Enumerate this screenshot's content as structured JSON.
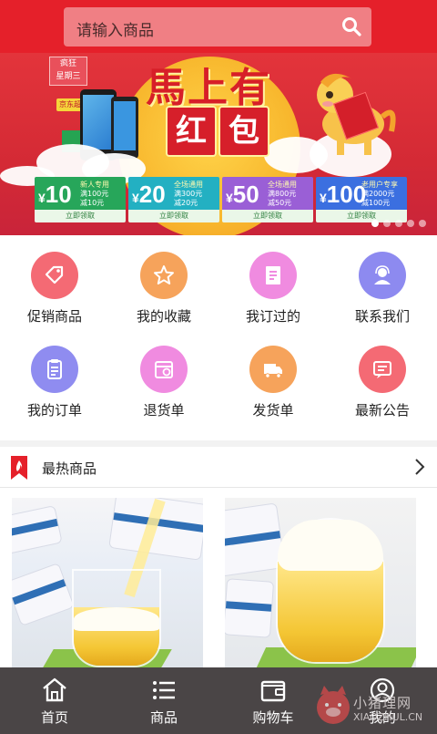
{
  "header": {
    "search_placeholder": "请输入商品",
    "search_icon": "search-icon"
  },
  "banner": {
    "ribbon_lines": [
      "疯狂",
      "星期三"
    ],
    "gift_tag": "京东超",
    "headline_top": "馬上有",
    "headline_bottom": [
      "红",
      "包"
    ],
    "coupons": [
      {
        "amount": "10",
        "tag": "新人专用",
        "line1": "满100元",
        "line2": "减10元",
        "button": "立即领取",
        "color": "#27a65a"
      },
      {
        "amount": "20",
        "tag": "全场通用",
        "line1": "满300元",
        "line2": "减20元",
        "button": "立即领取",
        "color": "#23b0c2"
      },
      {
        "amount": "50",
        "tag": "全场通用",
        "line1": "满800元",
        "line2": "减50元",
        "button": "立即领取",
        "color": "#9a5fd6"
      },
      {
        "amount": "100",
        "tag": "老用户专享",
        "line1": "满2000元",
        "line2": "减100元",
        "button": "立即领取",
        "color": "#3b6fe0"
      }
    ],
    "active_slide": 0,
    "slide_count": 5
  },
  "menu": {
    "items": [
      {
        "label": "促销商品",
        "icon": "price-tag-icon",
        "color": "#f46a74"
      },
      {
        "label": "我的收藏",
        "icon": "star-icon",
        "color": "#f6a35b"
      },
      {
        "label": "我订过的",
        "icon": "document-icon",
        "color": "#f08be0"
      },
      {
        "label": "联系我们",
        "icon": "customer-service-icon",
        "color": "#8d8af0"
      },
      {
        "label": "我的订单",
        "icon": "order-list-icon",
        "color": "#8f8cf0"
      },
      {
        "label": "退货单",
        "icon": "return-calendar-icon",
        "color": "#f08be0"
      },
      {
        "label": "发货单",
        "icon": "delivery-truck-icon",
        "color": "#f6a35b"
      },
      {
        "label": "最新公告",
        "icon": "announcement-icon",
        "color": "#f46a74"
      }
    ]
  },
  "hot": {
    "title": "最热商品",
    "badge_icon": "hot-flag-icon",
    "more_icon": "chevron-right-icon"
  },
  "tabbar": {
    "items": [
      {
        "label": "首页",
        "icon": "home-icon"
      },
      {
        "label": "商品",
        "icon": "list-icon"
      },
      {
        "label": "购物车",
        "icon": "wallet-cart-icon"
      },
      {
        "label": "我的",
        "icon": "user-icon"
      }
    ]
  },
  "watermark": {
    "text": "小猪理网",
    "sub": "XIAOZHUL.CN"
  }
}
